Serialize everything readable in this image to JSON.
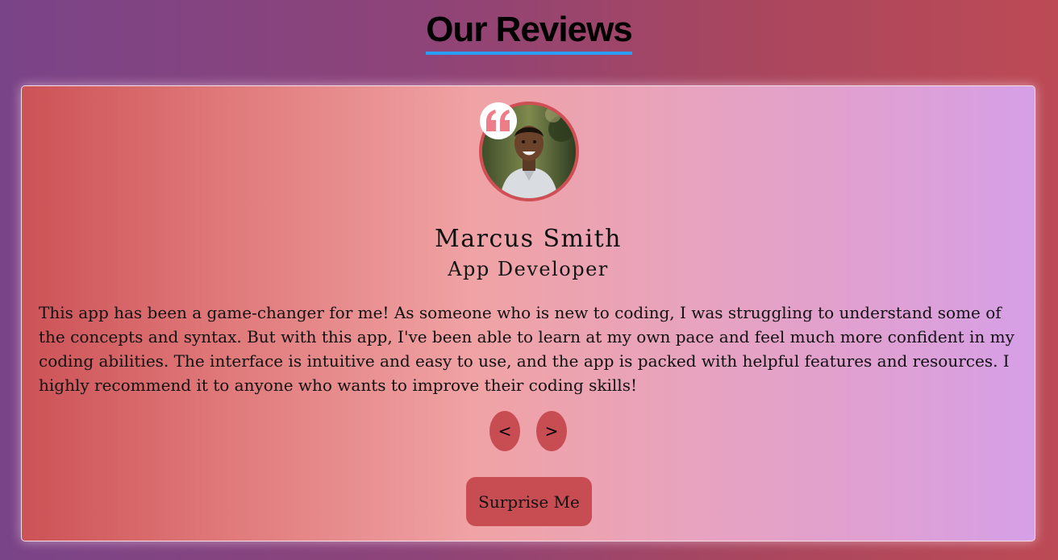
{
  "page": {
    "title": "Our Reviews"
  },
  "review": {
    "name": "Marcus Smith",
    "role": "App Developer",
    "text": "This app has been a game-changer for me! As someone who is new to coding, I was struggling to understand some of the concepts and syntax. But with this app, I've been able to learn at my own pace and feel much more confident in my coding abilities. The interface is intuitive and easy to use, and the app is packed with helpful features and resources. I highly recommend it to anyone who wants to improve their coding skills!",
    "avatar_icon": "person-photo",
    "quote_icon": "quote-icon"
  },
  "controls": {
    "prev_label": "<",
    "next_label": ">",
    "surprise_label": "Surprise Me"
  },
  "colors": {
    "accent_underline": "#2a9df4",
    "button": "#c84d52",
    "quote": "#ee7d8a"
  }
}
